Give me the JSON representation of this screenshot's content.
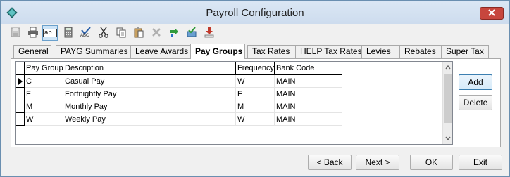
{
  "window": {
    "title": "Payroll Configuration"
  },
  "toolbar": {
    "buttons": [
      {
        "icon": "save-icon"
      },
      {
        "icon": "print-icon"
      },
      {
        "icon": "text-field-icon"
      },
      {
        "icon": "calculator-icon"
      },
      {
        "icon": "spellcheck-icon"
      },
      {
        "icon": "cut-icon"
      },
      {
        "icon": "copy-icon"
      },
      {
        "icon": "paste-icon"
      },
      {
        "icon": "delete-icon"
      },
      {
        "icon": "export-icon"
      },
      {
        "icon": "approve-icon"
      },
      {
        "icon": "download-icon"
      }
    ],
    "spellcheck_text": "ABC",
    "textfield_text": "ab|"
  },
  "tabs": [
    {
      "label": "General"
    },
    {
      "label": "PAYG Summaries"
    },
    {
      "label": "Leave Awards"
    },
    {
      "label": "Pay Groups"
    },
    {
      "label": "Tax Rates"
    },
    {
      "label": "HELP Tax Rates"
    },
    {
      "label": "Levies"
    },
    {
      "label": "Rebates"
    },
    {
      "label": "Super Tax"
    }
  ],
  "selected_tab": "Pay Groups",
  "grid": {
    "columns": [
      "Pay Group",
      "Description",
      "Frequency",
      "Bank Code"
    ],
    "rows": [
      [
        "C",
        "Casual Pay",
        "W",
        "MAIN"
      ],
      [
        "F",
        "Fortnightly Pay",
        "F",
        "MAIN"
      ],
      [
        "M",
        "Monthly Pay",
        "M",
        "MAIN"
      ],
      [
        "W",
        "Weekly Pay",
        "W",
        "MAIN"
      ]
    ],
    "current_row": 0
  },
  "side_buttons": {
    "add": "Add",
    "delete": "Delete"
  },
  "footer_buttons": {
    "back": "< Back",
    "next": "Next >",
    "ok": "OK",
    "exit": "Exit"
  },
  "colors": {
    "close_button": "#c7463d",
    "selected_tool": "#cde4f7"
  }
}
